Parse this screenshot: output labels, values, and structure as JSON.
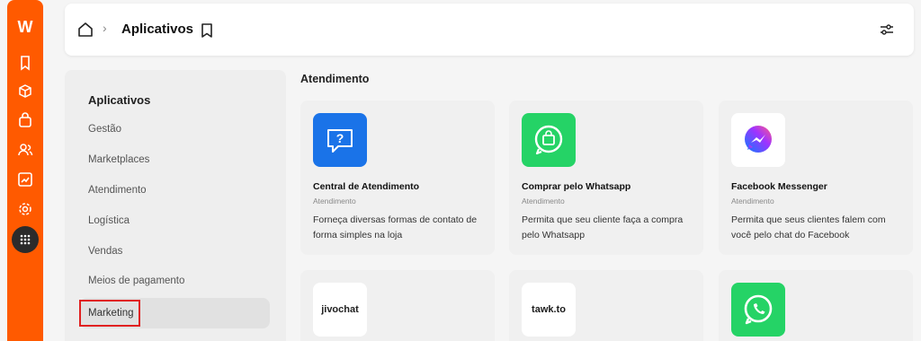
{
  "brand": {
    "logo": "W"
  },
  "rail": {
    "icons": [
      "bookmark-icon",
      "box-icon",
      "shopping-bag-icon",
      "users-icon",
      "chart-icon",
      "settings-icon",
      "apps-grid-icon"
    ]
  },
  "header": {
    "title": "Aplicativos",
    "separator": "›"
  },
  "categories": {
    "title": "Aplicativos",
    "items": [
      "Gestão",
      "Marketplaces",
      "Atendimento",
      "Logística",
      "Vendas",
      "Meios de pagamento",
      "Marketing"
    ],
    "active": "Marketing"
  },
  "section": {
    "title": "Atendimento"
  },
  "apps": [
    {
      "name": "Central de Atendimento",
      "category": "Atendimento",
      "description": "Forneça diversas formas de contato de forma simples na loja",
      "icon": "help-chat-icon"
    },
    {
      "name": "Comprar pelo Whatsapp",
      "category": "Atendimento",
      "description": "Permita que seu cliente faça a compra pelo Whatsapp",
      "icon": "whatsapp-bag-icon"
    },
    {
      "name": "Facebook Messenger",
      "category": "Atendimento",
      "description": "Permita que seus clientes falem com você pelo chat do Facebook",
      "icon": "messenger-icon"
    },
    {
      "name": "",
      "category": "",
      "description": "",
      "icon": "jivochat-logo",
      "logo_text": "jivochat"
    },
    {
      "name": "",
      "category": "",
      "description": "",
      "icon": "tawkto-logo",
      "logo_text": "tawk.to"
    },
    {
      "name": "",
      "category": "",
      "description": "",
      "icon": "whatsapp-icon"
    }
  ],
  "colors": {
    "rail": "#ff5a00",
    "highlight": "#e02020",
    "help_blue": "#1a73e8",
    "whatsapp_green": "#25d366"
  }
}
